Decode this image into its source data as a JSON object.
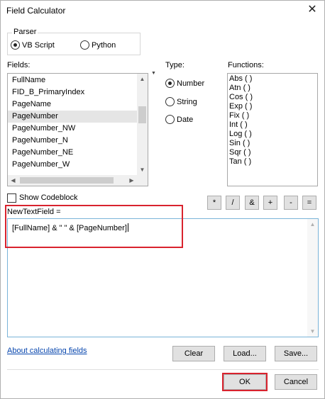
{
  "window": {
    "title": "Field Calculator"
  },
  "parser": {
    "label": "Parser",
    "options": [
      {
        "label": "VB Script",
        "checked": true
      },
      {
        "label": "Python",
        "checked": false
      }
    ]
  },
  "fields": {
    "label": "Fields:",
    "items": [
      "FullName",
      "FID_B_PrimaryIndex",
      "PageName",
      "PageNumber",
      "PageNumber_NW",
      "PageNumber_N",
      "PageNumber_NE",
      "PageNumber_W"
    ],
    "selected": "PageNumber"
  },
  "type": {
    "label": "Type:",
    "options": [
      {
        "label": "Number",
        "checked": true
      },
      {
        "label": "String",
        "checked": false
      },
      {
        "label": "Date",
        "checked": false
      }
    ]
  },
  "functions": {
    "label": "Functions:",
    "items": [
      "Abs ( )",
      "Atn ( )",
      "Cos ( )",
      "Exp ( )",
      "Fix ( )",
      "Int ( )",
      "Log ( )",
      "Sin ( )",
      "Sqr ( )",
      "Tan ( )"
    ]
  },
  "codeblock": {
    "label": "Show Codeblock",
    "checked": false
  },
  "operators": [
    "*",
    "/",
    "&",
    "+",
    "-",
    "="
  ],
  "expression": {
    "target_label": "NewTextField =",
    "value": "[FullName] & \" \" & [PageNumber]"
  },
  "link": {
    "label": "About calculating fields"
  },
  "buttons": {
    "clear": "Clear",
    "load": "Load...",
    "save": "Save...",
    "ok": "OK",
    "cancel": "Cancel"
  },
  "colors": {
    "highlight": "#d9232e",
    "link": "#0645ad",
    "focus_border": "#7ab4d8"
  }
}
